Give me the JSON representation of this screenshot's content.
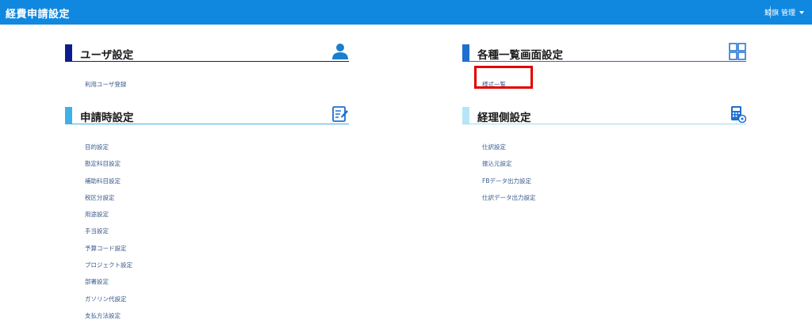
{
  "header": {
    "title": "経費申請設定",
    "user_menu_label": "鯨旗 管理"
  },
  "sections": {
    "user": {
      "title": "ユーザ設定",
      "icon": "user-icon",
      "color": "#0b1d8c",
      "links": [
        "利用ユーザ登録"
      ]
    },
    "list": {
      "title": "各種一覧画面設定",
      "icon": "grid-icon",
      "color": "#1e6fd0",
      "links": [
        "様式一覧"
      ]
    },
    "apply": {
      "title": "申請時設定",
      "icon": "edit-document-icon",
      "color": "#3fb1e8",
      "links": [
        "目的設定",
        "勘定科目設定",
        "補助科目設定",
        "税区分設定",
        "用途設定",
        "手当設定",
        "予算コード設定",
        "プロジェクト設定",
        "部署設定",
        "ガソリン代設定",
        "支払方法設定"
      ]
    },
    "acct": {
      "title": "経理側設定",
      "icon": "calculator-icon",
      "color": "#b7e5f7",
      "links": [
        "仕訳設定",
        "振込元設定",
        "FBデータ出力設定",
        "仕訳データ出力設定"
      ]
    }
  },
  "colors": {
    "header_bg": "#1088e0",
    "link": "#3a5a8c",
    "highlight": "#e00000"
  }
}
